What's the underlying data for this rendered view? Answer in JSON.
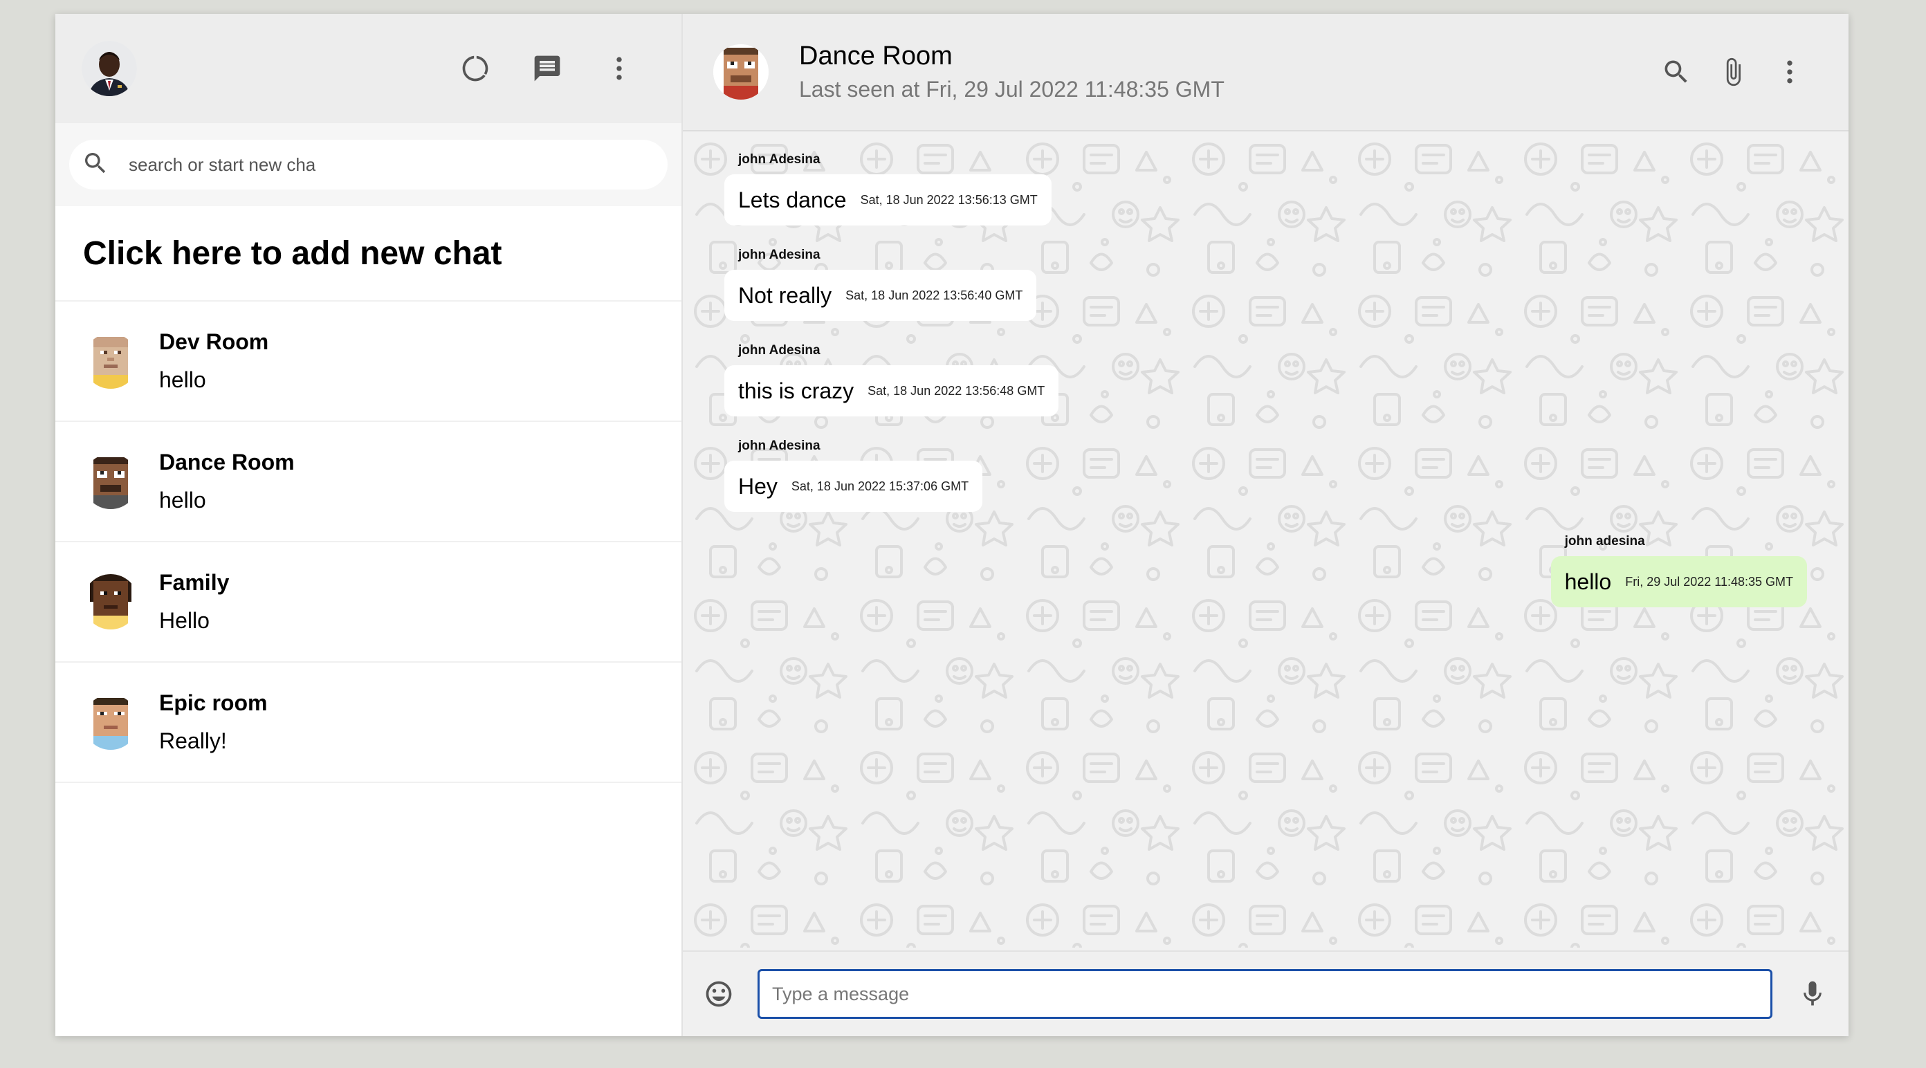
{
  "sidebar": {
    "search_placeholder": "search or start new cha",
    "add_chat_label": "Click here to add new chat",
    "header_icons": [
      "status-icon",
      "new-chat-icon",
      "menu-icon"
    ],
    "chats": [
      {
        "name": "Dev Room",
        "last_message": "hello",
        "avatar": "pixel-avatar-light"
      },
      {
        "name": "Dance Room",
        "last_message": "hello",
        "avatar": "pixel-avatar-brown"
      },
      {
        "name": "Family",
        "last_message": "Hello",
        "avatar": "pixel-avatar-dark"
      },
      {
        "name": "Epic room",
        "last_message": "Really!",
        "avatar": "pixel-avatar-blue"
      }
    ]
  },
  "chat": {
    "title": "Dance Room",
    "subtitle": "Last seen at Fri, 29 Jul 2022 11:48:35 GMT",
    "header_icons": [
      "search-icon",
      "attach-icon",
      "menu-icon"
    ],
    "messages": [
      {
        "sender": "john Adesina",
        "text": "Lets dance",
        "time": "Sat, 18 Jun 2022 13:56:13 GMT",
        "mine": false
      },
      {
        "sender": "john Adesina",
        "text": "Not really",
        "time": "Sat, 18 Jun 2022 13:56:40 GMT",
        "mine": false
      },
      {
        "sender": "john Adesina",
        "text": "this is crazy",
        "time": "Sat, 18 Jun 2022 13:56:48 GMT",
        "mine": false
      },
      {
        "sender": "john Adesina",
        "text": "Hey",
        "time": "Sat, 18 Jun 2022 15:37:06 GMT",
        "mine": false
      },
      {
        "sender": "john adesina",
        "text": "hello",
        "time": "Fri, 29 Jul 2022 11:48:35 GMT",
        "mine": true
      }
    ],
    "input_placeholder": "Type a message",
    "footer_icons": [
      "emoji-icon",
      "mic-icon"
    ]
  },
  "colors": {
    "header_bg": "#ededed",
    "own_bubble": "#dcf8c6",
    "input_border": "#1a4fa8",
    "chat_bg": "#f1f1f1"
  }
}
